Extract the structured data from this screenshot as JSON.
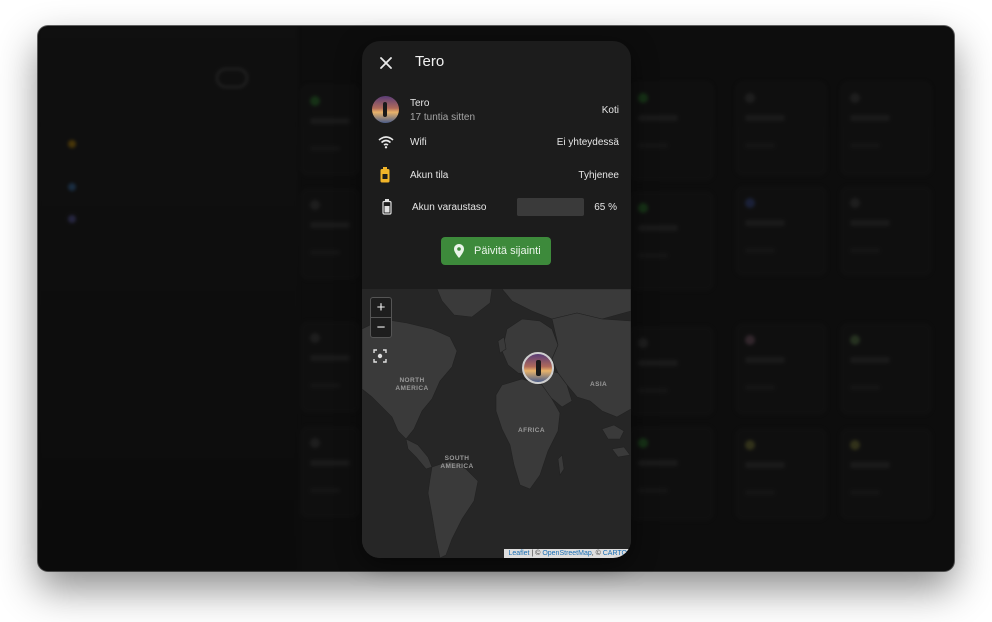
{
  "dialog": {
    "title": "Tero",
    "person": {
      "name": "Tero",
      "last_updated": "17 tuntia sitten",
      "state": "Koti"
    },
    "wifi": {
      "label": "Wifi",
      "value": "Ei yhteydessä"
    },
    "battery_state": {
      "label": "Akun tila",
      "value": "Tyhjenee"
    },
    "battery_level": {
      "label": "Akun varaustaso",
      "value": "65 %",
      "percent": 65
    },
    "update_button": "Päivitä sijainti"
  },
  "map": {
    "zoom_in": "+",
    "zoom_out": "−",
    "labels": {
      "north_america": "NORTH AMERICA",
      "asia": "ASIA",
      "africa": "AFRICA",
      "south_america": "SOUTH AMERICA"
    },
    "attribution": {
      "leaflet": "Leaflet",
      "sep1": " | © ",
      "osm": "OpenStreetMap",
      "sep2": ", © ",
      "carto": "CARTO"
    }
  },
  "colors": {
    "accent_green": "#3d8a3b",
    "battery_icon": "#f0b429",
    "dialog_bg": "#1c1c1c"
  }
}
